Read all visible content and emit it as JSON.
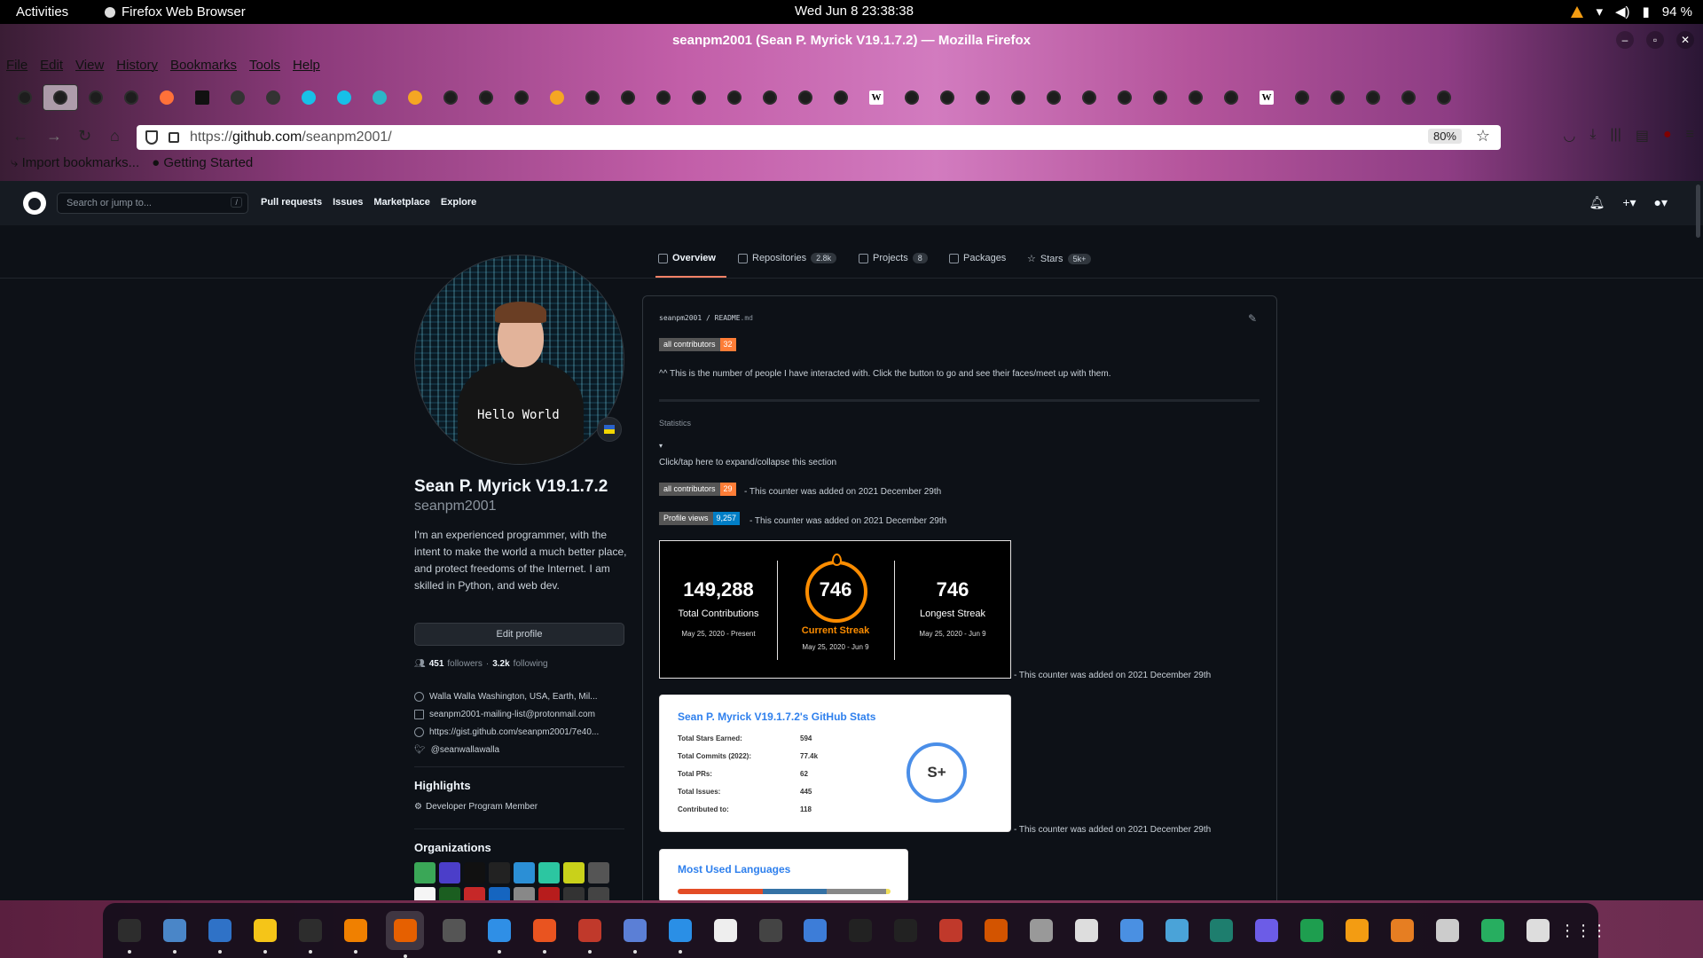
{
  "system": {
    "activities": "Activities",
    "app_name": "Firefox Web Browser",
    "clock": "Wed Jun 8  23:38:38",
    "battery": "94 %"
  },
  "window": {
    "title": "seanpm2001 (Sean P. Myrick V19.1.7.2) — Mozilla Firefox"
  },
  "menu": [
    "File",
    "Edit",
    "View",
    "History",
    "Bookmarks",
    "Tools",
    "Help"
  ],
  "tabs_icons": [
    "github",
    "github-active",
    "github",
    "github",
    "firefox",
    "medium",
    "settings",
    "puzzle",
    "star-blue",
    "star-blue",
    "cloud",
    "coin",
    "github",
    "github",
    "github",
    "rocket",
    "github",
    "github",
    "github",
    "github",
    "github",
    "github",
    "github",
    "github",
    "wikipedia",
    "github",
    "github",
    "github",
    "github",
    "github",
    "github",
    "github",
    "github",
    "github",
    "github",
    "wikipedia",
    "github",
    "github",
    "github",
    "github",
    "github"
  ],
  "navbar": {
    "url_prefix": "https://",
    "url_host": "github.com",
    "url_path": "/seanpm2001/",
    "zoom": "80%"
  },
  "bookmarks": [
    "Import bookmarks...",
    "Getting Started"
  ],
  "github_header": {
    "search_placeholder": "Search or jump to...",
    "search_key": "/",
    "nav": [
      "Pull requests",
      "Issues",
      "Marketplace",
      "Explore"
    ]
  },
  "profile_tabs": [
    {
      "label": "Overview",
      "count": ""
    },
    {
      "label": "Repositories",
      "count": "2.8k"
    },
    {
      "label": "Projects",
      "count": "8"
    },
    {
      "label": "Packages",
      "count": ""
    },
    {
      "label": "Stars",
      "count": "5k+"
    }
  ],
  "profile": {
    "avatar_shirt_text": "Hello World",
    "name": "Sean P. Myrick V19.1.7.2",
    "login": "seanpm2001",
    "bio": "I'm an experienced programmer, with the intent to make the world a much better place, and protect freedoms of the Internet. I am skilled in Python, and web dev.",
    "edit_button": "Edit profile",
    "followers_count": "451",
    "followers_label": "followers",
    "following_count": "3.2k",
    "following_label": "following",
    "location": "Walla Walla Washington, USA, Earth, Mil...",
    "email": "seanpm2001-mailing-list@protonmail.com",
    "website": "https://gist.github.com/seanpm2001/7e40...",
    "twitter": "@seanwallawalla",
    "highlights_title": "Highlights",
    "highlight_item": "Developer Program Member",
    "organizations_title": "Organizations",
    "org_colors": [
      "#3aa757",
      "#4b3ec9",
      "#111111",
      "#222222",
      "#2b8fd6",
      "#2cc6a1",
      "#c9d11a",
      "#555555",
      "#f5f5f5",
      "#1b5e20",
      "#c62828",
      "#1565c0",
      "#888888",
      "#b71c1c",
      "#333333",
      "#444444"
    ]
  },
  "readme": {
    "path_user": "seanpm2001",
    "path_file": "README",
    "path_ext": ".md",
    "badge1_label": "all contributors",
    "badge1_value": "32",
    "note": "^^ This is the number of people I have interacted with. Click the button to go and see their faces/meet up with them.",
    "section_title": "Statistics",
    "toggle_arrow": "▾",
    "expand_text": "Click/tap here to expand/collapse this section",
    "badge2_label": "all contributors",
    "badge2_value": "29",
    "badge2_note": "- This counter was added on 2021 December 29th",
    "badge3_label": "Profile views",
    "badge3_value": "9,257",
    "badge3_note": "- This counter was added on 2021 December 29th",
    "streak_note": "- This counter was added on 2021 December 29th",
    "stats_note": "- This counter was added on 2021 December 29th"
  },
  "streak_card": {
    "total": "149,288",
    "total_label": "Total Contributions",
    "total_range": "May 25, 2020 - Present",
    "current": "746",
    "current_label": "Current Streak",
    "current_range": "May 25, 2020 - Jun 9",
    "longest": "746",
    "longest_label": "Longest Streak",
    "longest_range": "May 25, 2020 - Jun 9"
  },
  "stats_card": {
    "title": "Sean P. Myrick V19.1.7.2's GitHub Stats",
    "rows": [
      {
        "k": "Total Stars Earned:",
        "v": "594"
      },
      {
        "k": "Total Commits (2022):",
        "v": "77.4k"
      },
      {
        "k": "Total PRs:",
        "v": "62"
      },
      {
        "k": "Total Issues:",
        "v": "445"
      },
      {
        "k": "Contributed to:",
        "v": "118"
      }
    ],
    "grade": "S+"
  },
  "lang_card": {
    "title": "Most Used Languages",
    "segments": [
      {
        "color": "#e34c26",
        "share": 0.4
      },
      {
        "color": "#3572a5",
        "share": 0.3
      },
      {
        "color": "#888888",
        "share": 0.28
      },
      {
        "color": "#f1e05a",
        "share": 0.02
      }
    ]
  },
  "dock_colors": [
    "#2d2d2d",
    "#4a86c8",
    "#2f72c7",
    "#f5c518",
    "#2d2d2d",
    "#f08000",
    "#e66000",
    "#555555",
    "#2f8fe6",
    "#e95420",
    "#c0392b",
    "#5b7fd6",
    "#2a8fe6",
    "#eeeeee",
    "#444444",
    "#3d7dd8",
    "#222222",
    "#222222",
    "#c0392b",
    "#d35400",
    "#999999",
    "#dddddd",
    "#4a90e2",
    "#4aa3d8",
    "#1e7e6e",
    "#6c5ce7",
    "#1e9e4f",
    "#f39c12",
    "#e67e22",
    "#cccccc",
    "#27ae60",
    "#dddddd"
  ]
}
